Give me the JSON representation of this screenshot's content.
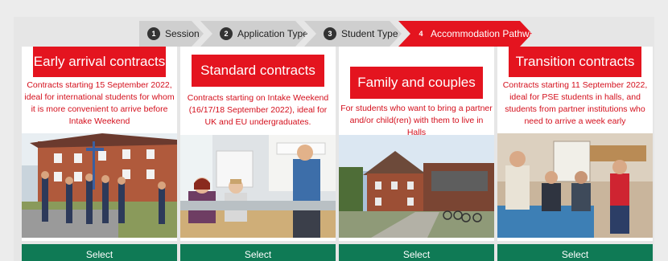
{
  "steps": [
    {
      "number": "1",
      "label": "Session"
    },
    {
      "number": "2",
      "label": "Application Type"
    },
    {
      "number": "3",
      "label": "Student Type"
    },
    {
      "number": "4",
      "label": "Accommodation Pathway",
      "active": true
    }
  ],
  "cards": [
    {
      "title": "Early arrival contracts",
      "description": "Contracts starting 15 September 2022, ideal for international students for whom it is more convenient to arrive before Intake Weekend",
      "select_label": "Select"
    },
    {
      "title": "Standard contracts",
      "description": "Contracts starting on Intake Weekend (16/17/18 September 2022), ideal for UK and EU undergraduates.",
      "select_label": "Select"
    },
    {
      "title": "Family and couples",
      "description": "For students who want to bring a partner and/or child(ren) with them to live in Halls",
      "select_label": "Select"
    },
    {
      "title": "Transition contracts",
      "description": "Contracts starting 11 September 2022, ideal for PSE students in halls, and students from partner institutions who need to arrive a week early",
      "select_label": "Select"
    }
  ],
  "colors": {
    "accent_red": "#e4141f",
    "description_red": "#d40f1c",
    "select_green": "#0f7a55",
    "step_inactive": "#cfcfcf"
  }
}
